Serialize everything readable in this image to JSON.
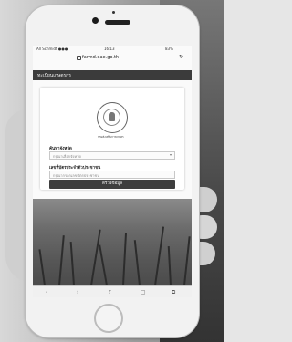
{
  "browser": {
    "url": "farmd.oae.go.th",
    "status_carrier": "All Schmidt ●●●",
    "status_time": "16:13",
    "status_battery": "83%",
    "reload_icon": "reload-icon"
  },
  "page": {
    "header_title": "ทะเบียนเกษตรกร",
    "seal_text": "กรมส่งเสริมการเกษตร",
    "province_label": "ค้นหาจังหวัด",
    "province_placeholder": "กรุณาเลือกจังหวัด",
    "farmer_label": "เลขที่บัตรประจำตัวประชาชน",
    "farmer_placeholder": "กรุณากรอกเลขบัตรประชาชน",
    "submit_label": "ตรวจข้อมูล"
  },
  "toolbar": {
    "back": "‹",
    "forward": "›",
    "share": "⇪",
    "bookmarks": "▢",
    "tabs": "⧉"
  }
}
